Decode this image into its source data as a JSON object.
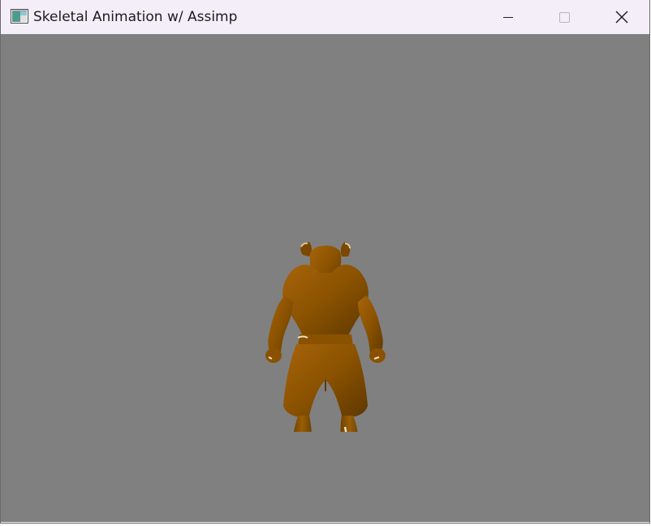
{
  "window": {
    "title": "Skeletal Animation w/ Assimp",
    "controls": {
      "minimize": "minimize-icon",
      "maximize": "maximize-icon",
      "close": "close-icon"
    }
  },
  "viewport": {
    "background_color": "#808080",
    "model_color": "#8a5200"
  }
}
